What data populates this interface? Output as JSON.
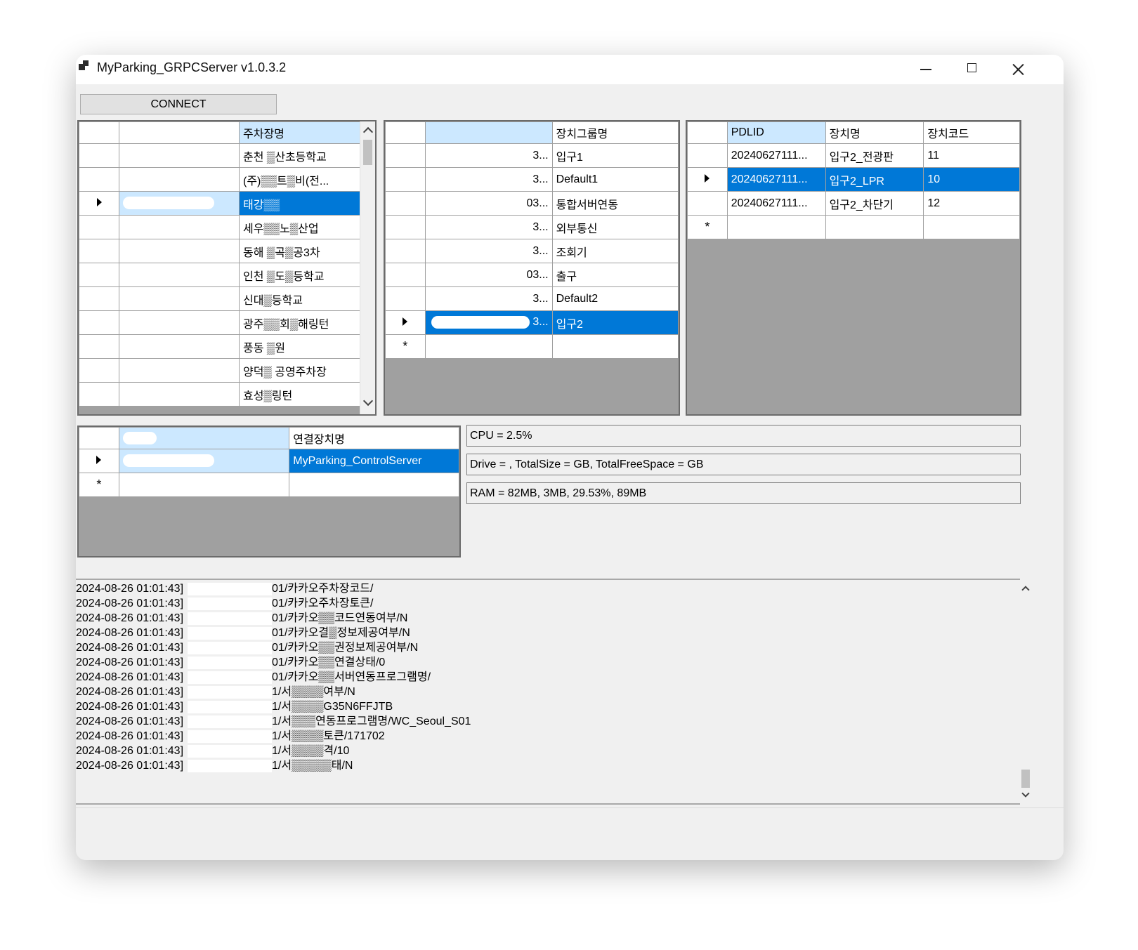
{
  "window": {
    "title": "MyParking_GRPCServer v1.0.3.2"
  },
  "toolbar": {
    "connect_label": "CONNECT"
  },
  "parking_grid": {
    "header": "주차장명",
    "selected_index": 2,
    "rows": [
      "춘천 ▒산초등학교",
      "(주)▒▒트▒비(전...",
      "태강▒▒",
      "세우▒▒노▒산업",
      "동해 ▒곡▒공3차",
      "인천 ▒도▒등학교",
      "신대▒등학교",
      "광주▒▒회▒해링턴",
      "풍동 ▒원",
      "양덕▒ 공영주차장",
      "효성▒링턴"
    ]
  },
  "group_grid": {
    "header": "장치그룹명",
    "selected_index": 7,
    "rows": [
      {
        "code": "3...",
        "name": "입구1"
      },
      {
        "code": "3...",
        "name": "Default1"
      },
      {
        "code": "03...",
        "name": "통합서버연동"
      },
      {
        "code": "3...",
        "name": "외부통신"
      },
      {
        "code": "3...",
        "name": "조회기"
      },
      {
        "code": "03...",
        "name": "출구"
      },
      {
        "code": "3...",
        "name": "Default2"
      },
      {
        "code": "3...",
        "name": "입구2"
      }
    ]
  },
  "device_grid": {
    "headers": [
      "PDLID",
      "장치명",
      "장치코드"
    ],
    "selected_index": 1,
    "rows": [
      {
        "pdlid": "20240627111...",
        "name": "입구2_전광판",
        "code": "11"
      },
      {
        "pdlid": "20240627111...",
        "name": "입구2_LPR",
        "code": "10"
      },
      {
        "pdlid": "20240627111...",
        "name": "입구2_차단기",
        "code": "12"
      }
    ]
  },
  "connection_grid": {
    "header": "연결장치명",
    "rows": [
      "MyParking_ControlServer"
    ]
  },
  "stats": {
    "cpu": "CPU = 2.5%",
    "drive": "Drive =       , TotalSize =           GB, TotalFreeSpace =           GB",
    "ram": "RAM =        82MB,          3MB, 29.53%,          89MB"
  },
  "log": [
    {
      "time": "2024-08-26 01:01:43]",
      "text": "01/카카오주차장코드/"
    },
    {
      "time": "2024-08-26 01:01:43]",
      "text": "01/카카오주차장토큰/"
    },
    {
      "time": "2024-08-26 01:01:43]",
      "text": "01/카카오▒▒코드연동여부/N"
    },
    {
      "time": "2024-08-26 01:01:43]",
      "text": "01/카카오결▒정보제공여부/N"
    },
    {
      "time": "2024-08-26 01:01:43]",
      "text": "01/카카오▒▒권정보제공여부/N"
    },
    {
      "time": "2024-08-26 01:01:43]",
      "text": "01/카카오▒▒연결상태/0"
    },
    {
      "time": "2024-08-26 01:01:43]",
      "text": "01/카카오▒▒서버연동프로그램명/"
    },
    {
      "time": "2024-08-26 01:01:43]",
      "text": "1/서▒▒▒▒여부/N"
    },
    {
      "time": "2024-08-26 01:01:43]",
      "text": "1/서▒▒▒▒G35N6FFJTB"
    },
    {
      "time": "2024-08-26 01:01:43]",
      "text": "1/서▒▒▒연동프로그램명/WC_Seoul_S01"
    },
    {
      "time": "2024-08-26 01:01:43]",
      "text": "1/서▒▒▒▒토큰/171702"
    },
    {
      "time": "2024-08-26 01:01:43]",
      "text": "1/서▒▒▒▒격/10"
    },
    {
      "time": "2024-08-26 01:01:43]",
      "text": "1/서▒▒▒▒▒태/N"
    }
  ]
}
